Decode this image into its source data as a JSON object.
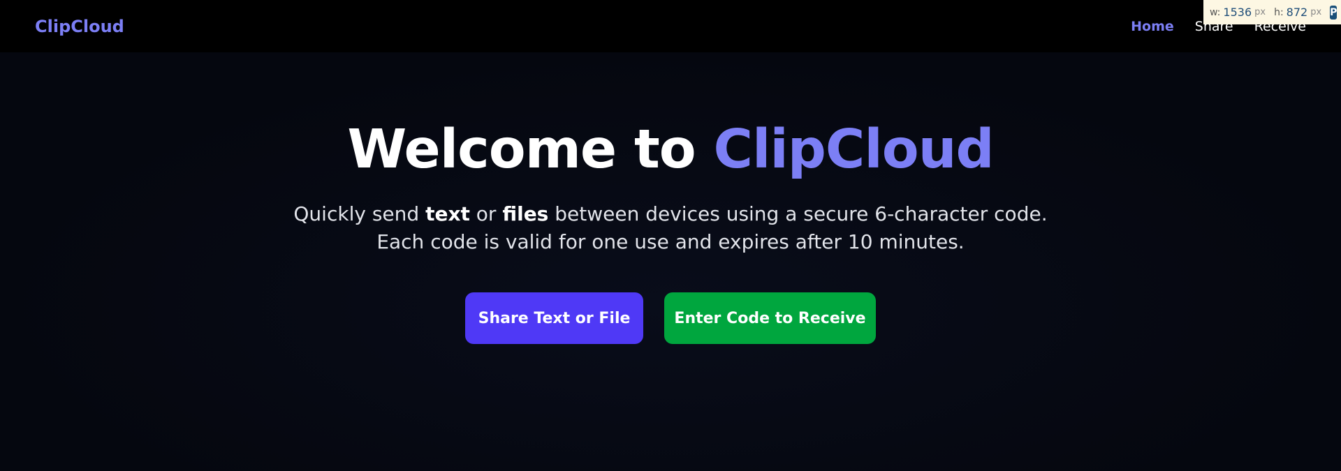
{
  "nav": {
    "brand": "ClipCloud",
    "links": [
      {
        "label": "Home",
        "active": true
      },
      {
        "label": "Share",
        "active": false
      },
      {
        "label": "Receive",
        "active": false
      }
    ]
  },
  "overlay": {
    "w_label": "w:",
    "w_value": "1536",
    "w_unit": "px",
    "h_label": "h:",
    "h_value": "872",
    "h_unit": "px"
  },
  "hero": {
    "title_prefix": "Welcome to ",
    "title_accent": "ClipCloud",
    "desc_part1": "Quickly send ",
    "desc_bold1": "text",
    "desc_part2": " or ",
    "desc_bold2": "files",
    "desc_part3": " between devices using a secure 6-character code. Each code is valid for one use and expires after 10 minutes."
  },
  "actions": {
    "share_label": "Share Text or File",
    "receive_label": "Enter Code to Receive"
  },
  "colors": {
    "accent": "#7c7ff5",
    "share_button": "#4f39f6",
    "receive_button": "#00a63e",
    "background": "#05070f",
    "navbar": "#000000"
  }
}
